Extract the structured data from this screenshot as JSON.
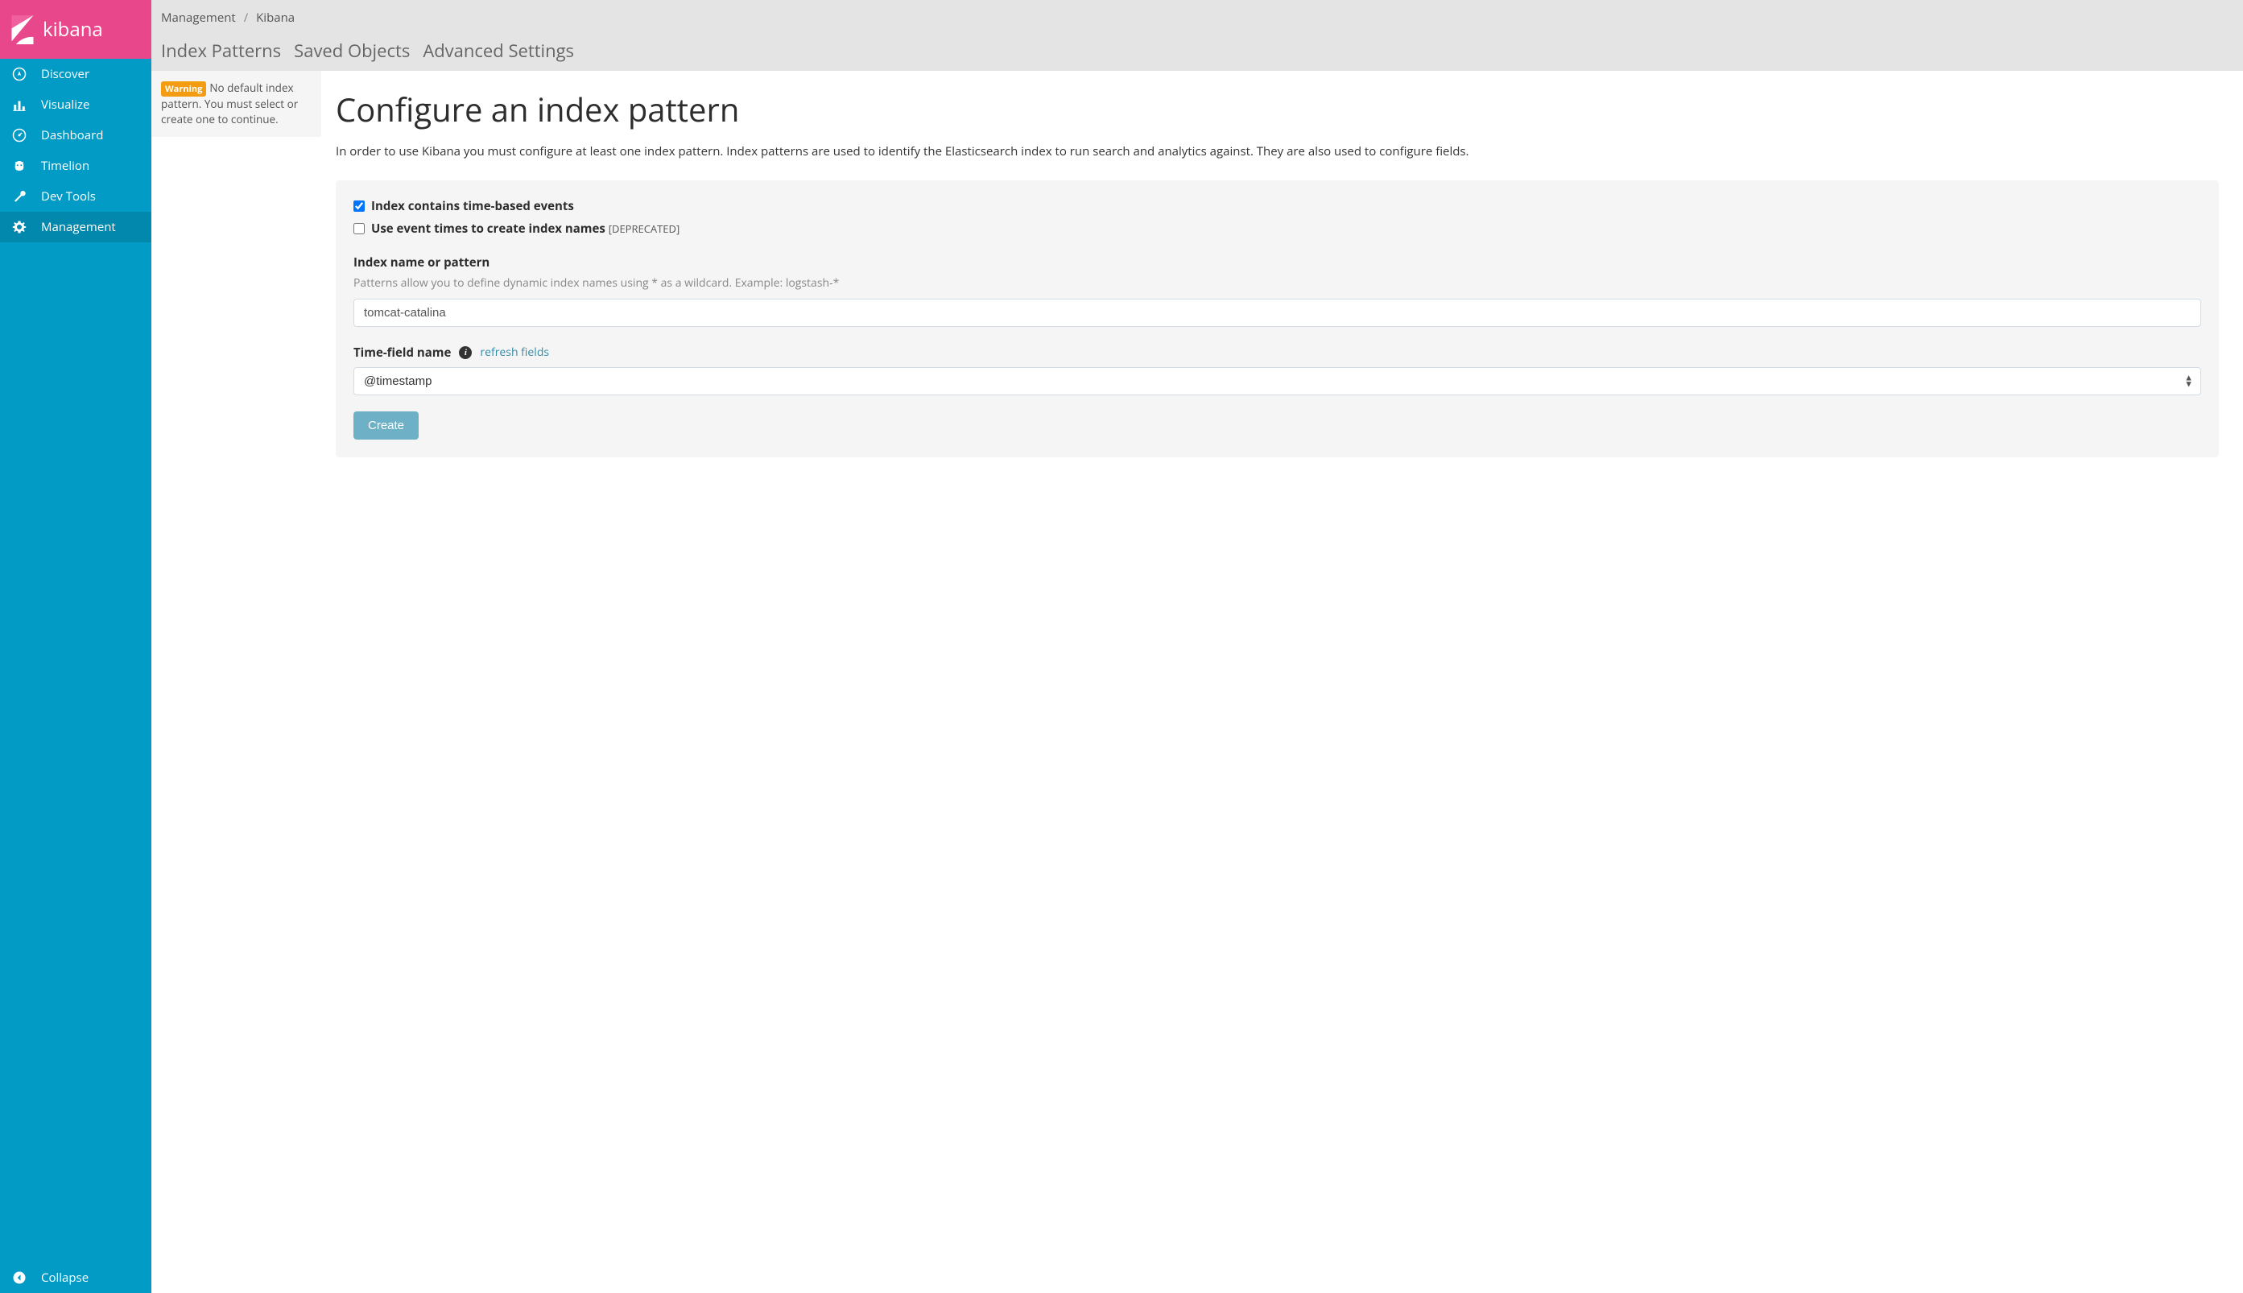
{
  "brand": {
    "name": "kibana"
  },
  "sidebar": {
    "items": [
      {
        "label": "Discover",
        "icon": "compass-icon"
      },
      {
        "label": "Visualize",
        "icon": "barchart-icon"
      },
      {
        "label": "Dashboard",
        "icon": "gauge-icon"
      },
      {
        "label": "Timelion",
        "icon": "bear-icon"
      },
      {
        "label": "Dev Tools",
        "icon": "wrench-icon"
      },
      {
        "label": "Management",
        "icon": "gear-icon"
      }
    ],
    "collapse_label": "Collapse"
  },
  "breadcrumb": {
    "parent": "Management",
    "separator": "/",
    "current": "Kibana"
  },
  "tabs": [
    {
      "label": "Index Patterns"
    },
    {
      "label": "Saved Objects"
    },
    {
      "label": "Advanced Settings"
    }
  ],
  "warning": {
    "badge": "Warning",
    "text": "No default index pattern. You must select or create one to continue."
  },
  "page": {
    "title": "Configure an index pattern",
    "description": "In order to use Kibana you must configure at least one index pattern. Index patterns are used to identify the Elasticsearch index to run search and analytics against. They are also used to configure fields."
  },
  "form": {
    "checkbox1_label": "Index contains time-based events",
    "checkbox2_label": "Use event times to create index names",
    "deprecated_tag": "[DEPRECATED]",
    "index_label": "Index name or pattern",
    "index_hint": "Patterns allow you to define dynamic index names using * as a wildcard. Example: logstash-*",
    "index_value": "tomcat-catalina",
    "timefield_label": "Time-field name",
    "refresh_link": "refresh fields",
    "timefield_value": "@timestamp",
    "create_button": "Create"
  }
}
